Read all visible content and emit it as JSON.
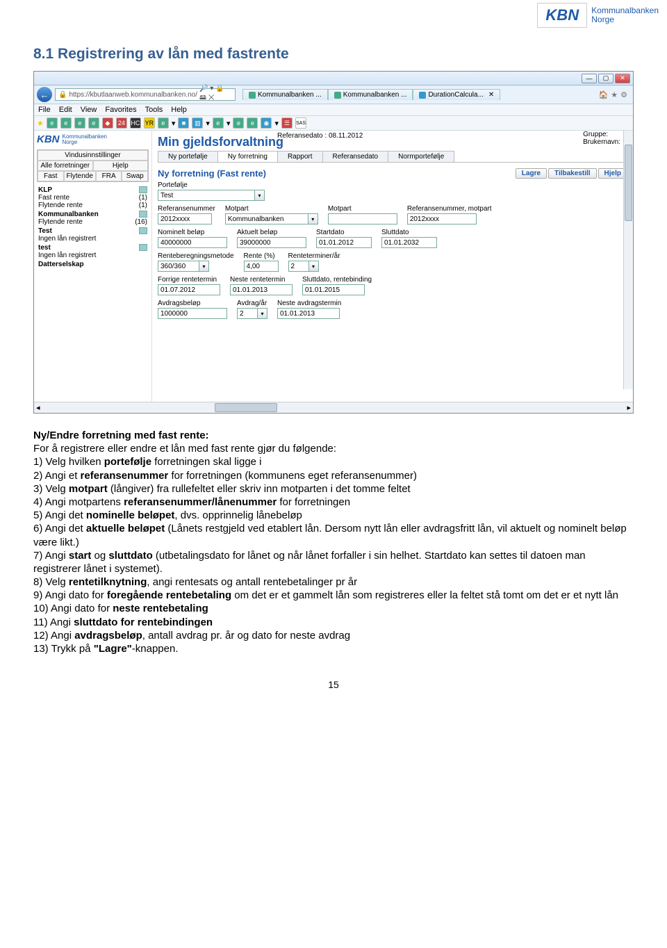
{
  "logo": {
    "abbrev": "KBN",
    "line1": "Kommunalbanken",
    "line2": "Norge"
  },
  "heading": "8.1 Registrering av lån med fastrente",
  "browser": {
    "url": "https://kbutlaanweb.kommunalbanken.no/",
    "url_suffix": "🔎 ▾ 🔒 🖴 ✕",
    "tabs": [
      "Kommunalbanken ...",
      "Kommunalbanken ...",
      "DurationCalcula..."
    ],
    "menu": [
      "File",
      "Edit",
      "View",
      "Favorites",
      "Tools",
      "Help"
    ]
  },
  "sidebar": {
    "panel1_h": "Vindusinnstillinger",
    "panel1_r": [
      "Alle forretninger",
      "Hjelp"
    ],
    "panel2_r": [
      "Fast",
      "Flytende",
      "FRA",
      "Swap"
    ],
    "groups": [
      {
        "head": "KLP",
        "lines": [
          [
            "Fast rente",
            "(1)"
          ],
          [
            "Flytende rente",
            "(1)"
          ]
        ]
      },
      {
        "head": "Kommunalbanken",
        "lines": [
          [
            "Flytende rente",
            "(16)"
          ]
        ]
      },
      {
        "head": "Test",
        "lines": [
          [
            "Ingen lån registrert",
            ""
          ]
        ]
      },
      {
        "head": "test",
        "lines": [
          [
            "Ingen lån registrert",
            ""
          ]
        ]
      },
      {
        "head": "Datterselskap",
        "lines": []
      }
    ]
  },
  "app": {
    "ref_date_label": "Referansedato :",
    "ref_date_value": "08.11.2012",
    "gruppe": "Gruppe:",
    "bruker": "Brukernavn:",
    "title": "Min gjeldsforvaltning",
    "tabs": [
      "Ny portefølje",
      "Ny forretning",
      "Rapport",
      "Referansedato",
      "Normportefølje"
    ],
    "form_title": "Ny forretning (Fast rente)",
    "buttons": [
      "Lagre",
      "Tilbakestill",
      "Hjelp"
    ],
    "fields": {
      "portefolje": {
        "label": "Portefølje",
        "value": "Test"
      },
      "refnr": {
        "label": "Referansenummer",
        "value": "2012xxxx"
      },
      "motpart_dd": {
        "label": "Motpart",
        "value": "Kommunalbanken"
      },
      "motpart_txt": {
        "label": "Motpart",
        "value": ""
      },
      "refnr_motpart": {
        "label": "Referansenummer, motpart",
        "value": "2012xxxx"
      },
      "nominelt": {
        "label": "Nominelt beløp",
        "value": "40000000"
      },
      "aktuelt": {
        "label": "Aktuelt beløp",
        "value": "39000000"
      },
      "startdato": {
        "label": "Startdato",
        "value": "01.01.2012"
      },
      "sluttdato": {
        "label": "Sluttdato",
        "value": "01.01.2032"
      },
      "rbm": {
        "label": "Renteberegningsmetode",
        "value": "360/360"
      },
      "rente": {
        "label": "Rente (%)",
        "value": "4,00"
      },
      "rta": {
        "label": "Renteterminer/år",
        "value": "2"
      },
      "forrige_rt": {
        "label": "Forrige rentetermin",
        "value": "01.07.2012"
      },
      "neste_rt": {
        "label": "Neste rentetermin",
        "value": "01.01.2013"
      },
      "slutt_rb": {
        "label": "Sluttdato, rentebinding",
        "value": "01.01.2015"
      },
      "avdragsbelop": {
        "label": "Avdragsbeløp",
        "value": "1000000"
      },
      "avdrag_ar": {
        "label": "Avdrag/år",
        "value": "2"
      },
      "neste_at": {
        "label": "Neste avdragstermin",
        "value": "01.01.2013"
      }
    }
  },
  "instr": {
    "h": "Ny/Endre forretning med fast rente:",
    "p0": "For å registrere eller endre et lån med fast rente gjør du følgende:",
    "l1a": "1) Velg hvilken ",
    "l1b": "portefølje",
    "l1c": " forretningen skal ligge i",
    "l2a": "2) Angi et ",
    "l2b": "referansenummer",
    "l2c": " for forretningen (kommunens eget referansenummer)",
    "l3a": "3) Velg ",
    "l3b": "motpart",
    "l3c": " (långiver) fra rullefeltet eller skriv inn motparten i det tomme feltet",
    "l4a": "4) Angi motpartens ",
    "l4b": "referansenummer/lånenummer",
    "l4c": " for forretningen",
    "l5a": "5) Angi det ",
    "l5b": "nominelle beløpet",
    "l5c": ", dvs. opprinnelig lånebeløp",
    "l6a": "6) Angi det ",
    "l6b": "aktuelle beløpet",
    "l6c": " (Lånets restgjeld ved etablert lån. Dersom nytt lån eller avdragsfritt lån, vil aktuelt og nominelt beløp være likt.)",
    "l7a": "7) Angi ",
    "l7b": "start",
    "l7c": " og ",
    "l7d": "sluttdato",
    "l7e": " (utbetalingsdato for lånet og når lånet forfaller i sin helhet. Startdato kan settes til datoen man registrerer lånet i systemet).",
    "l8a": "8) Velg ",
    "l8b": "rentetilknytning",
    "l8c": ", angi rentesats og antall rentebetalinger pr år",
    "l9a": "9) Angi dato for ",
    "l9b": "foregående rentebetaling",
    "l9c": " om det er et gammelt lån som registreres eller la feltet stå tomt om det er et nytt lån",
    "l10a": "10) Angi dato for ",
    "l10b": "neste rentebetaling",
    "l11a": "11) Angi ",
    "l11b": "sluttdato for rentebindingen",
    "l12a": "12) Angi ",
    "l12b": "avdragsbeløp",
    "l12c": ", antall avdrag pr. år og dato for neste avdrag",
    "l13a": "13) Trykk på ",
    "l13b": "\"Lagre\"",
    "l13c": "-knappen."
  },
  "page_number": "15"
}
